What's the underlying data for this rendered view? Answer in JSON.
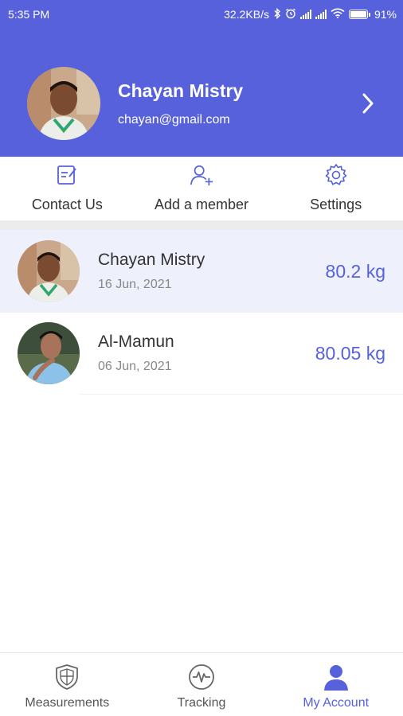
{
  "status_bar": {
    "time": "5:35 PM",
    "network_speed": "32.2KB/s",
    "battery_percent": "91%",
    "icons": [
      "bluetooth-icon",
      "alarm-icon",
      "signal-icon",
      "signal-icon",
      "wifi-icon",
      "battery-icon"
    ]
  },
  "profile": {
    "name": "Chayan Mistry",
    "email": "chayan@gmail.com",
    "avatar": "user-photo"
  },
  "actions": [
    {
      "label": "Contact Us",
      "icon": "edit-note-icon"
    },
    {
      "label": "Add a member",
      "icon": "add-user-icon"
    },
    {
      "label": "Settings",
      "icon": "gear-icon"
    }
  ],
  "members": [
    {
      "name": "Chayan Mistry",
      "date": "16 Jun, 2021",
      "weight": "80.2 kg",
      "selected": true
    },
    {
      "name": "Al-Mamun",
      "date": "06 Jun, 2021",
      "weight": "80.05 kg",
      "selected": false
    }
  ],
  "bottom_nav": [
    {
      "label": "Measurements",
      "icon": "shield-icon",
      "active": false
    },
    {
      "label": "Tracking",
      "icon": "pulse-icon",
      "active": false
    },
    {
      "label": "My Account",
      "icon": "account-icon",
      "active": true
    }
  ],
  "colors": {
    "primary": "#5761dc",
    "selected_row": "#eef0fb",
    "divider": "#ececec"
  }
}
